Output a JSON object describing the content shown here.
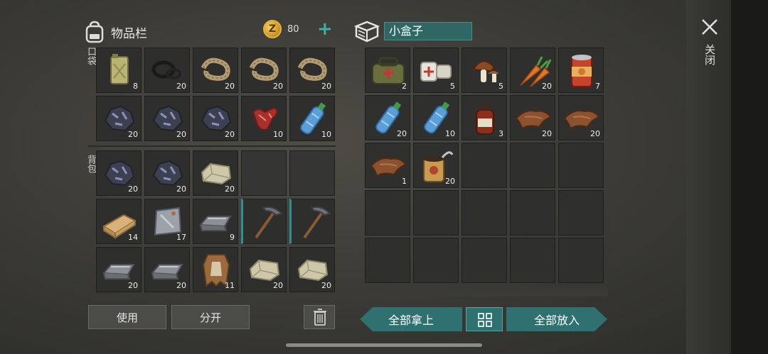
{
  "inventory": {
    "title": "物品栏",
    "coins": "80",
    "pocket_label": "口袋",
    "backpack_label": "背包",
    "pocket": [
      {
        "item": "jerry-can",
        "qty": "8"
      },
      {
        "item": "rubber-rings",
        "qty": "20"
      },
      {
        "item": "rope",
        "qty": "20"
      },
      {
        "item": "rope",
        "qty": "20"
      },
      {
        "item": "rope",
        "qty": "20"
      },
      {
        "item": "coal-ore",
        "qty": "20"
      },
      {
        "item": "coal-ore",
        "qty": "20"
      },
      {
        "item": "coal-ore",
        "qty": "20"
      },
      {
        "item": "raw-meat",
        "qty": "10"
      },
      {
        "item": "water-bottle",
        "qty": "10"
      }
    ],
    "backpack": [
      {
        "item": "coal-ore",
        "qty": "20"
      },
      {
        "item": "coal-ore",
        "qty": "20"
      },
      {
        "item": "limestone",
        "qty": "20"
      },
      {
        "item": "",
        "qty": ""
      },
      {
        "item": "",
        "qty": ""
      },
      {
        "item": "wood-plank",
        "qty": "14"
      },
      {
        "item": "metal-plate",
        "qty": "17"
      },
      {
        "item": "iron-ingot",
        "qty": "9"
      },
      {
        "item": "pickaxe",
        "qty": ""
      },
      {
        "item": "pickaxe",
        "qty": ""
      },
      {
        "item": "iron-ingot",
        "qty": "20"
      },
      {
        "item": "iron-ingot",
        "qty": "20"
      },
      {
        "item": "leather-hide",
        "qty": "11"
      },
      {
        "item": "limestone",
        "qty": "20"
      },
      {
        "item": "limestone",
        "qty": "20"
      }
    ],
    "use_label": "使用",
    "split_label": "分开"
  },
  "container": {
    "name": "小盒子",
    "slots": [
      {
        "item": "medkit-bag",
        "qty": "2"
      },
      {
        "item": "bandages",
        "qty": "5"
      },
      {
        "item": "mushrooms",
        "qty": "5"
      },
      {
        "item": "carrots",
        "qty": "20"
      },
      {
        "item": "canned-food",
        "qty": "7"
      },
      {
        "item": "water-bottle",
        "qty": "20"
      },
      {
        "item": "water-bottle",
        "qty": "10"
      },
      {
        "item": "medicine-bottle",
        "qty": "3"
      },
      {
        "item": "leather-scrap",
        "qty": "20"
      },
      {
        "item": "leather-scrap",
        "qty": "20"
      },
      {
        "item": "leather-scrap",
        "qty": "1"
      },
      {
        "item": "open-can",
        "qty": "20"
      }
    ],
    "take_all_label": "全部拿上",
    "put_all_label": "全部放入"
  },
  "close_label": "关闭",
  "colors": {
    "accent": "#2f7170",
    "accent_light": "#3cb3a2",
    "coin": "#e3b23c"
  }
}
